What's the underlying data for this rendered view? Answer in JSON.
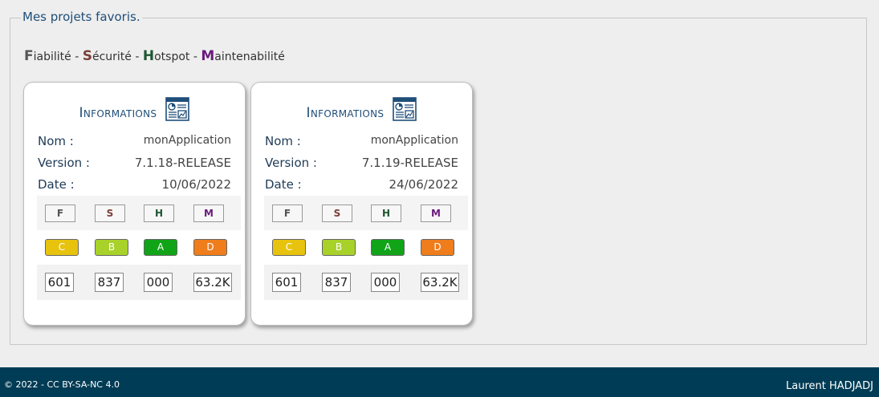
{
  "fieldset": {
    "legend": "Mes projets favoris."
  },
  "legend_line": {
    "f_letter": "F",
    "f_rest": "iabilité",
    "sep1": " - ",
    "s_letter": "S",
    "s_rest": "écurité",
    "sep2": " - ",
    "h_letter": "H",
    "h_rest": "otspot",
    "sep3": " - ",
    "m_letter": "M",
    "m_rest": "aintenabilité"
  },
  "colors": {
    "rating_A": "#11a418",
    "rating_B": "#a8d22a",
    "rating_C": "#e8c30e",
    "rating_D": "#ef7d1b"
  },
  "cards": [
    {
      "title": "Informations",
      "icon": "report-icon",
      "nom_label": "Nom :",
      "nom": "monApplication",
      "version_label": "Version :",
      "version": "7.1.18-RELEASE",
      "date_label": "Date :",
      "date": "10/06/2022",
      "headers": [
        "F",
        "S",
        "H",
        "M"
      ],
      "ratings": [
        "C",
        "B",
        "A",
        "D"
      ],
      "values": [
        "601",
        "837",
        "000",
        "63.2K"
      ]
    },
    {
      "title": "Informations",
      "icon": "report-icon",
      "nom_label": "Nom :",
      "nom": "monApplication",
      "version_label": "Version :",
      "version": "7.1.19-RELEASE",
      "date_label": "Date :",
      "date": "24/06/2022",
      "headers": [
        "F",
        "S",
        "H",
        "M"
      ],
      "ratings": [
        "C",
        "B",
        "A",
        "D"
      ],
      "values": [
        "601",
        "837",
        "000",
        "63.2K"
      ]
    }
  ],
  "footer": {
    "left": "© 2022 - CC BY-SA-NC 4.0",
    "right": "Laurent HADJADJ"
  }
}
